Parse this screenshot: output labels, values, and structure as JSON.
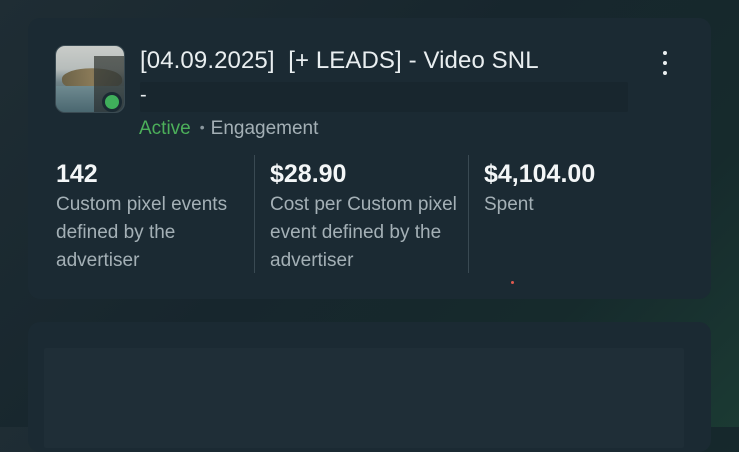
{
  "campaign": {
    "title": "[04.09.2025]  [+ LEADS] - Video SNL",
    "title_continuation": "-",
    "status": "Active",
    "separator": "•",
    "objective": "Engagement",
    "status_color": "#4caf5a",
    "thumbnail_icon": "video-thumbnail"
  },
  "metrics": [
    {
      "value": "142",
      "label": "Custom pixel events defined by the advertiser"
    },
    {
      "value": "$28.90",
      "label": "Cost per Custom pixel event defined by the advertiser"
    },
    {
      "value": "$4,104.00",
      "label": "Spent"
    }
  ],
  "menu": {
    "icon": "more-vertical-icon"
  }
}
